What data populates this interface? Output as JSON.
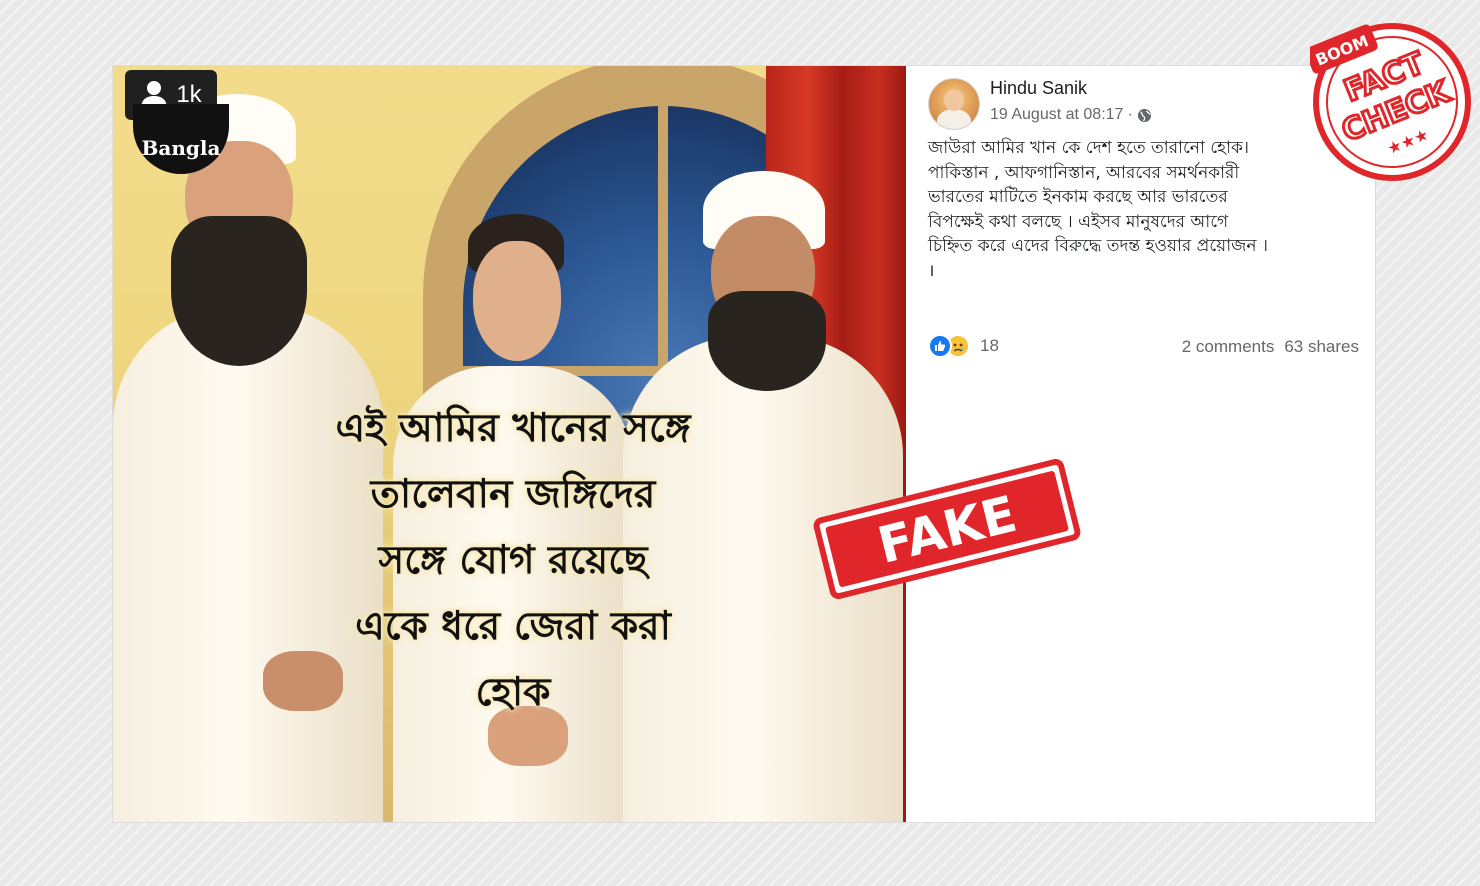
{
  "photo": {
    "badge": {
      "icon": "person-icon",
      "count": "1k"
    },
    "channel_logo": "Bangla",
    "overlay_lines": [
      "এই আমির খানের সঙ্গে",
      "তালেবান জঙ্গিদের",
      "সঙ্গে যোগ রয়েছে",
      "একে ধরে জেরা করা",
      "হোক"
    ]
  },
  "post": {
    "author": "Hindu Sanik",
    "timestamp": "19 August at 08:17",
    "separator": "·",
    "privacy_icon": "globe-icon",
    "body": "জাউরা আমির খান কে দেশ হতে তারানো হোক।\nপাকিস্তান , আফগানিস্তান, আরবের সমর্থনকারী\nভারতের মাটিতে ইনকাম করছে আর ভারতের\nবিপক্ষেই কথা বলছে । এইসব মানুষদের আগে\nচিহ্নিত করে এদের বিরুদ্ধে তদন্ত হওয়ার প্রয়োজন ।\n।",
    "reaction_icons": [
      "like-icon",
      "sad-icon"
    ],
    "reaction_count": "18",
    "comments": "2 comments",
    "shares": "63 shares"
  },
  "stamps": {
    "fake": "FAKE",
    "boom": "BOOM",
    "fact": "FACT",
    "check": "CHECK",
    "stars": "★★★"
  },
  "colors": {
    "stamp_red": "#e0262b",
    "facebook_blue": "#1877f2",
    "meta_gray": "#65676b",
    "sad_yellow": "#f7c237"
  }
}
